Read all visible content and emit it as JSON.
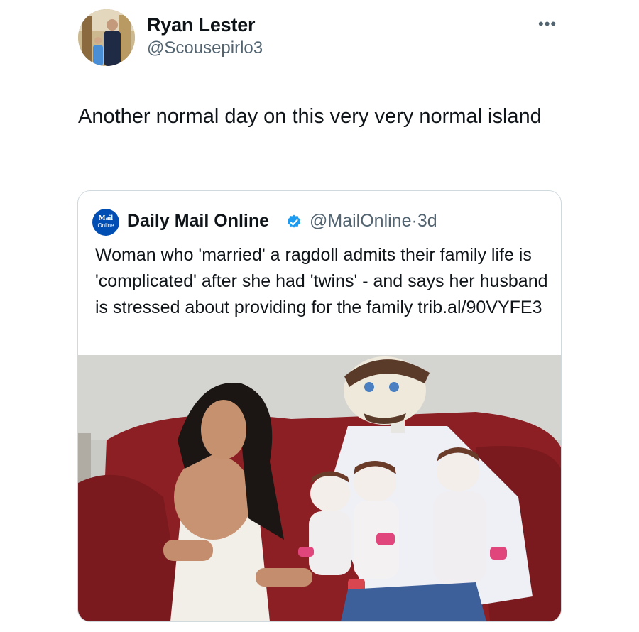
{
  "post": {
    "author_name": "Ryan Lester",
    "author_handle": "@Scousepirlo3",
    "more_label": "•••",
    "text": "Another normal day on this very very normal island"
  },
  "quoted": {
    "logo_line1": "Mail",
    "logo_line2": "Online",
    "author_name": "Daily Mail Online",
    "verified_icon": "verified-badge-icon",
    "author_handle": "@MailOnline",
    "separator": "·",
    "time": "3d",
    "text": "Woman who 'married' a ragdoll admits their family life is 'complicated' after she had 'twins' - and says her husband is stressed about providing for the family trib.al/90VYFE3"
  },
  "colors": {
    "verified_blue": "#1d9bf0",
    "logo_blue": "#004db3",
    "secondary_text": "#536471",
    "border": "#cfd9de"
  }
}
